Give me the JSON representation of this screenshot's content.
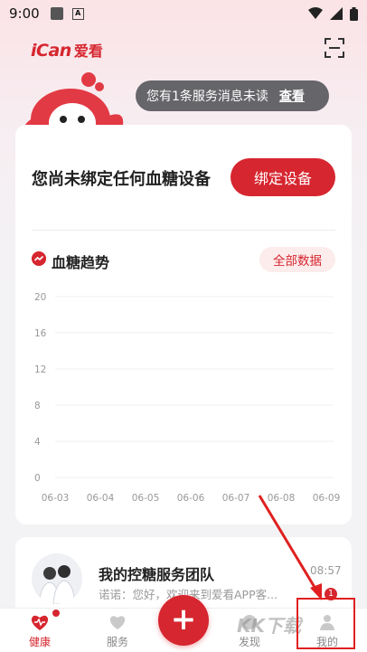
{
  "status_bar": {
    "time": "9:00"
  },
  "header": {
    "logo_en": "iCan",
    "logo_cn": "爱看"
  },
  "notice": {
    "text": "您有1条服务消息未读",
    "link": "查看"
  },
  "device": {
    "title": "您尚未绑定任何血糖设备",
    "bind_button": "绑定设备"
  },
  "trend": {
    "title": "血糖趋势",
    "all_data_button": "全部数据"
  },
  "chart_data": {
    "type": "line",
    "title": "血糖趋势",
    "x": [
      "06-03",
      "06-04",
      "06-05",
      "06-06",
      "06-07",
      "06-08",
      "06-09"
    ],
    "y_ticks": [
      0,
      4,
      8,
      12,
      16,
      20
    ],
    "ylim": [
      0,
      20
    ],
    "series": [],
    "grid": true
  },
  "team": {
    "name": "我的控糖服务团队",
    "time": "08:57",
    "message": "诺诺：您好，欢迎来到爱看APP客..."
  },
  "tabbar": {
    "tabs": [
      {
        "label": "健康"
      },
      {
        "label": "服务"
      },
      {
        "label": "发现"
      },
      {
        "label": "我的"
      }
    ],
    "fab": "+",
    "mine_badge": "1"
  },
  "watermark": "KK下载",
  "colors": {
    "accent": "#d6262f",
    "highlight": "#e02020"
  }
}
